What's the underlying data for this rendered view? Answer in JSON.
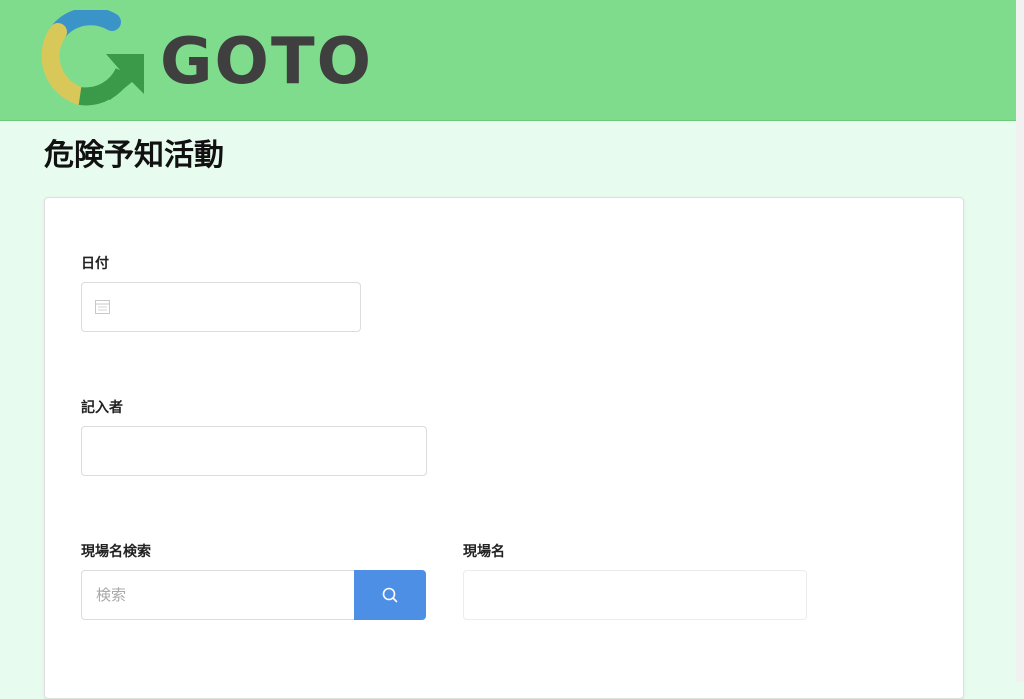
{
  "header": {
    "logo_text": "GOTO",
    "colors": {
      "header_bg": "#7fdc8c",
      "logo_blue": "#3b94c8",
      "logo_yellow": "#d8c85a",
      "logo_green": "#3a9a4a",
      "logo_text": "#3f3f3f"
    }
  },
  "page": {
    "title": "危険予知活動",
    "background": "#e8fbef"
  },
  "form": {
    "date": {
      "label": "日付",
      "value": "",
      "icon": "calendar-icon"
    },
    "author": {
      "label": "記入者",
      "value": ""
    },
    "site_search": {
      "label": "現場名検索",
      "placeholder": "検索",
      "button_icon": "search-icon",
      "button_color": "#4e8fe6"
    },
    "site_name": {
      "label": "現場名",
      "value": ""
    }
  }
}
